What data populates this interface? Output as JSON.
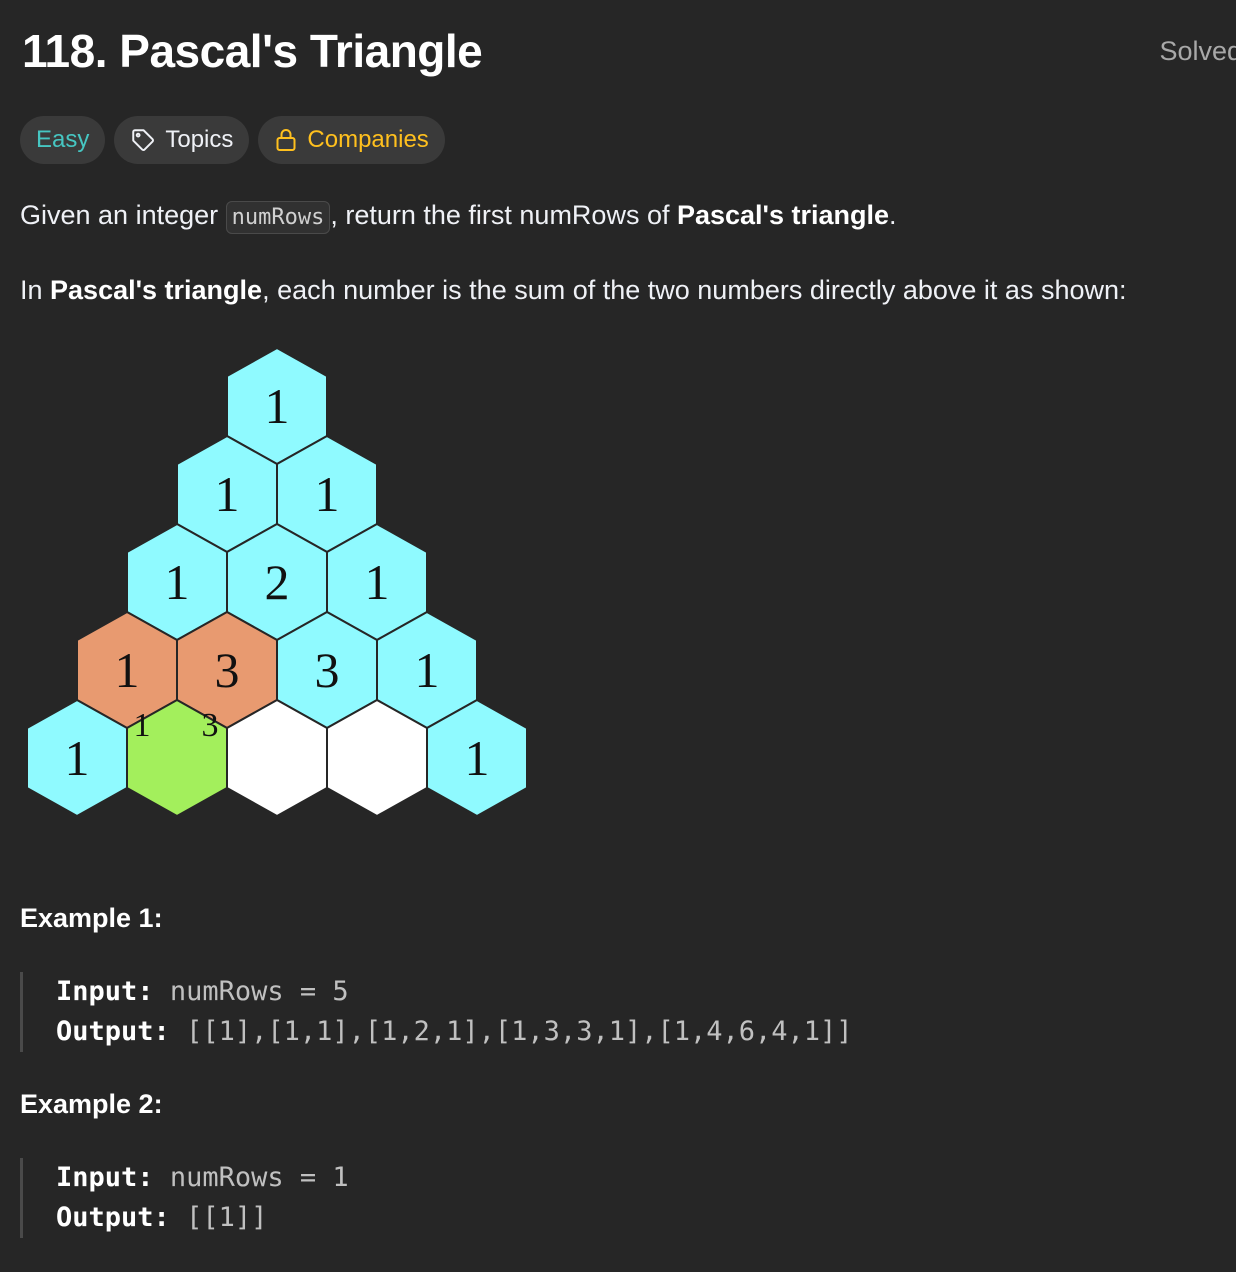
{
  "header": {
    "title": "118. Pascal's Triangle",
    "status": "Solved"
  },
  "tags": {
    "difficulty": "Easy",
    "topics": "Topics",
    "companies": "Companies"
  },
  "colors": {
    "easy": "#46c6c2",
    "companies": "#ffc01e",
    "cyan_cell": "#8ffaff",
    "orange_cell": "#e89a70",
    "green_cell": "#a3ef5c",
    "empty_cell": "#ffffff"
  },
  "description": {
    "p1_before": "Given an integer ",
    "p1_code": "numRows",
    "p1_after": ", return the first numRows of ",
    "p1_bold": "Pascal's triangle",
    "p1_end": ".",
    "p2_before": "In ",
    "p2_bold": "Pascal's triangle",
    "p2_after": ", each number is the sum of the two numbers directly above it as shown:"
  },
  "triangle": {
    "rows": [
      [
        "1"
      ],
      [
        "1",
        "1"
      ],
      [
        "1",
        "2",
        "1"
      ],
      [
        "1",
        "3",
        "3",
        "1"
      ],
      [
        "1",
        "",
        "",
        "",
        "1"
      ]
    ],
    "small_labels": [
      "1",
      "3"
    ]
  },
  "examples": [
    {
      "title": "Example 1:",
      "input_label": "Input:",
      "input_value": "numRows = 5",
      "output_label": "Output:",
      "output_value": "[[1],[1,1],[1,2,1],[1,3,3,1],[1,4,6,4,1]]"
    },
    {
      "title": "Example 2:",
      "input_label": "Input:",
      "input_value": "numRows = 1",
      "output_label": "Output:",
      "output_value": "[[1]]"
    }
  ]
}
